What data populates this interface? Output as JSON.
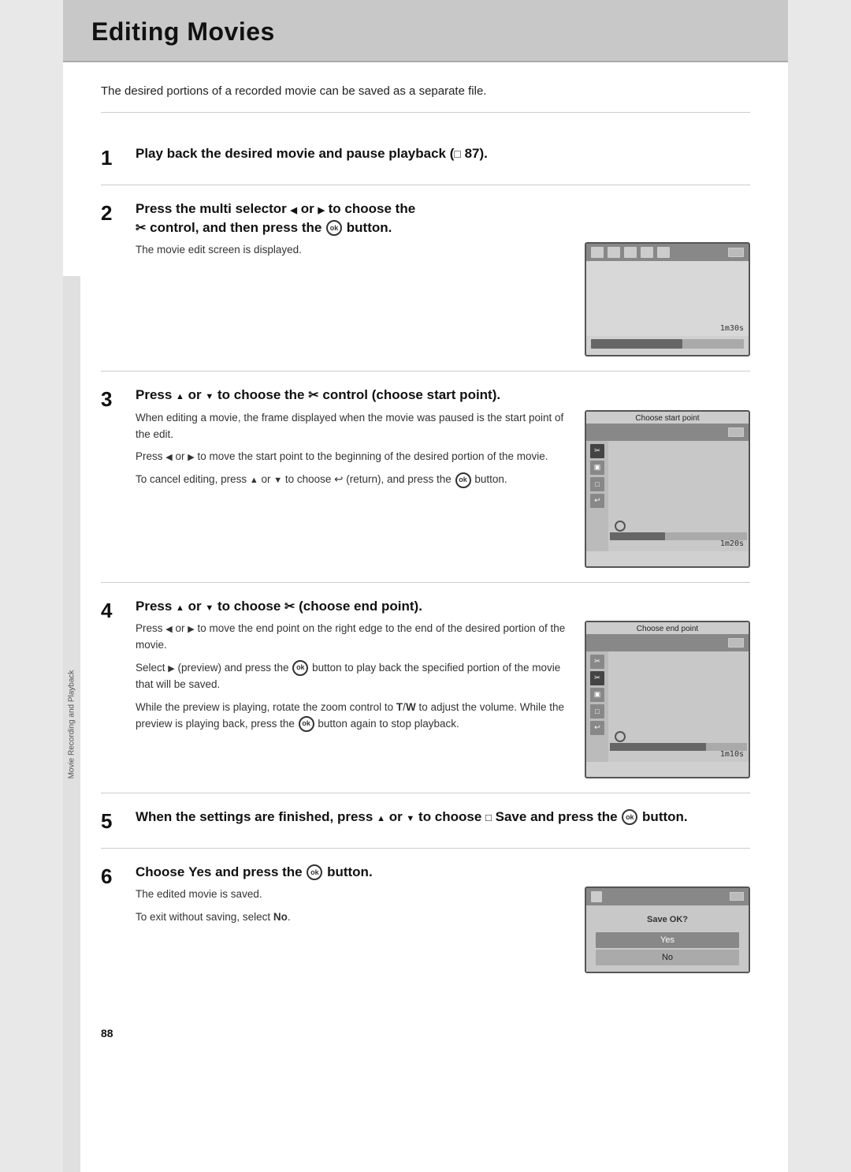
{
  "page": {
    "title": "Editing Movies",
    "page_number": "88",
    "intro": "The desired portions of a recorded movie can be saved as a separate file.",
    "sidebar_label": "Movie Recording and Playback"
  },
  "steps": [
    {
      "number": "1",
      "header": "Play back the desired movie and pause playback (□ 87).",
      "has_image": false,
      "paragraphs": []
    },
    {
      "number": "2",
      "header": "Press the multi selector ◀ or ▶ to choose the ✂ control, and then press the ⊛ button.",
      "has_image": true,
      "image_type": "screen1",
      "paragraphs": [
        "The movie edit screen is displayed."
      ]
    },
    {
      "number": "3",
      "header": "Press ▲ or ▼ to choose the ✂ control (choose start point).",
      "has_image": true,
      "image_type": "screen2",
      "paragraphs": [
        "When editing a movie, the frame displayed when the movie was paused is the start point of the edit.",
        "Press ◀ or ▶ to move the start point to the beginning of the desired portion of the movie.",
        "To cancel editing, press ▲ or ▼ to choose ↩ (return), and press the ⊛ button."
      ]
    },
    {
      "number": "4",
      "header": "Press ▲ or ▼ to choose ✂ (choose end point).",
      "has_image": true,
      "image_type": "screen3",
      "paragraphs": [
        "Press ◀ or ▶ to move the end point on the right edge to the end of the desired portion of the movie.",
        "Select ▶ (preview) and press the ⊛ button to play back the specified portion of the movie that will be saved.",
        "While the preview is playing, rotate the zoom control to T/W to adjust the volume. While the preview is playing back, press the ⊛ button again to stop playback."
      ]
    },
    {
      "number": "5",
      "header": "When the settings are finished, press ▲ or ▼ to choose □ Save and press the ⊛ button.",
      "has_image": false,
      "paragraphs": []
    },
    {
      "number": "6",
      "header": "Choose Yes and press the ⊛ button.",
      "has_image": true,
      "image_type": "screen6",
      "paragraphs": [
        "The edited movie is saved.",
        "To exit without saving, select No."
      ]
    }
  ],
  "screens": {
    "screen1": {
      "timecode": "1m30s",
      "label": ""
    },
    "screen2": {
      "timecode": "1m20s",
      "label": "Choose start point"
    },
    "screen3": {
      "timecode": "1m10s",
      "label": "Choose end point"
    },
    "screen6": {
      "save_label": "Save OK?",
      "yes": "Yes",
      "no": "No"
    }
  }
}
